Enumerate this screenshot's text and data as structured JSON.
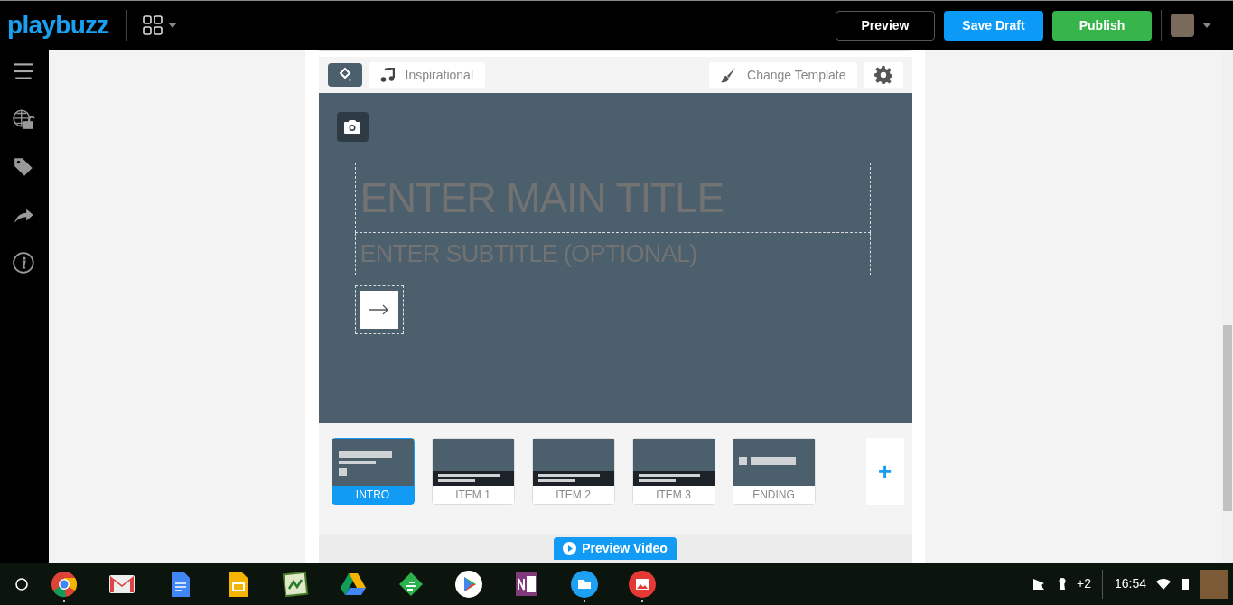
{
  "header": {
    "logo": "playbuzz",
    "buttons": [
      {
        "label": "Preview",
        "kind": "outline"
      },
      {
        "label": "Save Draft",
        "kind": "primary"
      },
      {
        "label": "Publish",
        "kind": "success"
      }
    ]
  },
  "sidebar": {
    "items": [
      {
        "kind": "menu"
      },
      {
        "kind": "globe"
      },
      {
        "kind": "tag"
      },
      {
        "kind": "share"
      },
      {
        "kind": "info"
      }
    ]
  },
  "toolbar": {
    "music": "Inspirational",
    "template": "Change Template"
  },
  "editor": {
    "title_placeholder": "ENTER MAIN TITLE",
    "subtitle_placeholder": "ENTER SUBTITLE (OPTIONAL)"
  },
  "slides": [
    {
      "label": "INTRO",
      "kind": "intro",
      "selected": true
    },
    {
      "label": "ITEM 1",
      "kind": "item",
      "selected": false
    },
    {
      "label": "ITEM 2",
      "kind": "item",
      "selected": false
    },
    {
      "label": "ITEM 3",
      "kind": "item",
      "selected": false
    },
    {
      "label": "ENDING",
      "kind": "ending",
      "selected": false
    }
  ],
  "add_slide": "+",
  "preview_video": "Preview Video",
  "taskbar": {
    "apps": [
      {
        "kind": "chrome",
        "running": true
      },
      {
        "kind": "gmail",
        "running": false
      },
      {
        "kind": "docs",
        "running": false
      },
      {
        "kind": "slides",
        "running": false
      },
      {
        "kind": "sheet",
        "running": false
      },
      {
        "kind": "drive",
        "running": false
      },
      {
        "kind": "feedly",
        "running": false
      },
      {
        "kind": "play",
        "running": false
      },
      {
        "kind": "onenote",
        "running": false
      },
      {
        "kind": "files",
        "running": true
      },
      {
        "kind": "photos",
        "running": true
      }
    ],
    "notifications": "+2",
    "time": "16:54"
  }
}
